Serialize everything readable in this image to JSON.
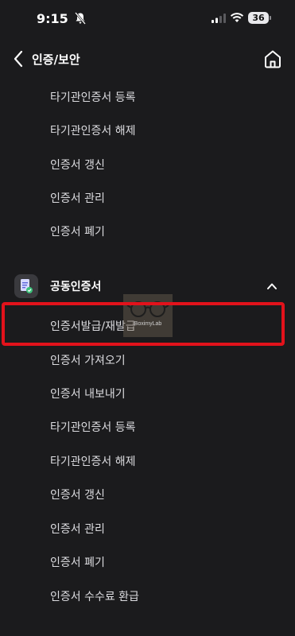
{
  "status_bar": {
    "time": "9:15",
    "battery": "36",
    "icons": [
      "bell-off-icon",
      "signal-icon",
      "wifi-icon",
      "battery-icon"
    ]
  },
  "nav": {
    "title": "인증/보안",
    "back_icon": "chevron-left-icon",
    "home_icon": "home-icon"
  },
  "menu_top": {
    "items": [
      {
        "label": "타기관인증서 등록"
      },
      {
        "label": "타기관인증서 해제"
      },
      {
        "label": "인증서 갱신"
      },
      {
        "label": "인증서 관리"
      },
      {
        "label": "인증서 폐기"
      }
    ]
  },
  "section": {
    "title": "공동인증서",
    "icon": "certificate-icon",
    "expand_icon": "chevron-up-icon",
    "items": [
      {
        "label": "인증서발급/재발급",
        "highlighted": true
      },
      {
        "label": "인증서 가져오기"
      },
      {
        "label": "인증서 내보내기"
      },
      {
        "label": "타기관인증서 등록"
      },
      {
        "label": "타기관인증서 해제"
      },
      {
        "label": "인증서 갱신"
      },
      {
        "label": "인증서 관리"
      },
      {
        "label": "인증서 폐기"
      },
      {
        "label": "인증서 수수료 환급"
      }
    ]
  },
  "overlay": {
    "highlight_color": "#e2121b",
    "watermark_text": "BoximyLab"
  },
  "colors": {
    "background": "#1b1b1d",
    "text": "#dcdce0"
  }
}
